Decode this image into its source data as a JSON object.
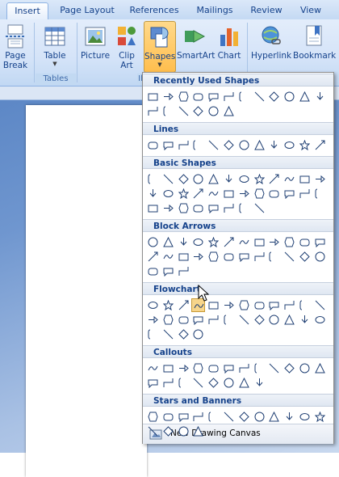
{
  "ribbon": {
    "tabs": [
      "Insert",
      "Page Layout",
      "References",
      "Mailings",
      "Review",
      "View"
    ],
    "active_tab": "Insert",
    "buttons": {
      "page_break": "Page Break",
      "table": "Table",
      "picture": "Picture",
      "clip_art": "Clip Art",
      "shapes": "Shapes",
      "smartart": "SmartArt",
      "chart": "Chart",
      "hyperlink": "Hyperlink",
      "bookmark": "Bookmark"
    },
    "groups": {
      "tables": "Tables",
      "illustrations_partial": "Il"
    }
  },
  "shapes_menu": {
    "sections": [
      {
        "title": "Recently Used Shapes",
        "rows": [
          12,
          6
        ]
      },
      {
        "title": "Lines",
        "rows": [
          12
        ]
      },
      {
        "title": "Basic Shapes",
        "rows": [
          12,
          12,
          8
        ]
      },
      {
        "title": "Block Arrows",
        "rows": [
          12,
          12,
          3
        ]
      },
      {
        "title": "Flowchart",
        "rows": [
          12,
          12,
          4
        ]
      },
      {
        "title": "Callouts",
        "rows": [
          12,
          8
        ]
      },
      {
        "title": "Stars and Banners",
        "rows": [
          12,
          4
        ]
      }
    ],
    "highlighted": {
      "section": 4,
      "row": 0,
      "index": 3
    },
    "footer_label": "New Drawing Canvas"
  },
  "colors": {
    "ribbon_top": "#dbe8f9",
    "pressed": "#ffbe4e",
    "text": "#15428b",
    "doc_bg": "#6f96cf"
  }
}
